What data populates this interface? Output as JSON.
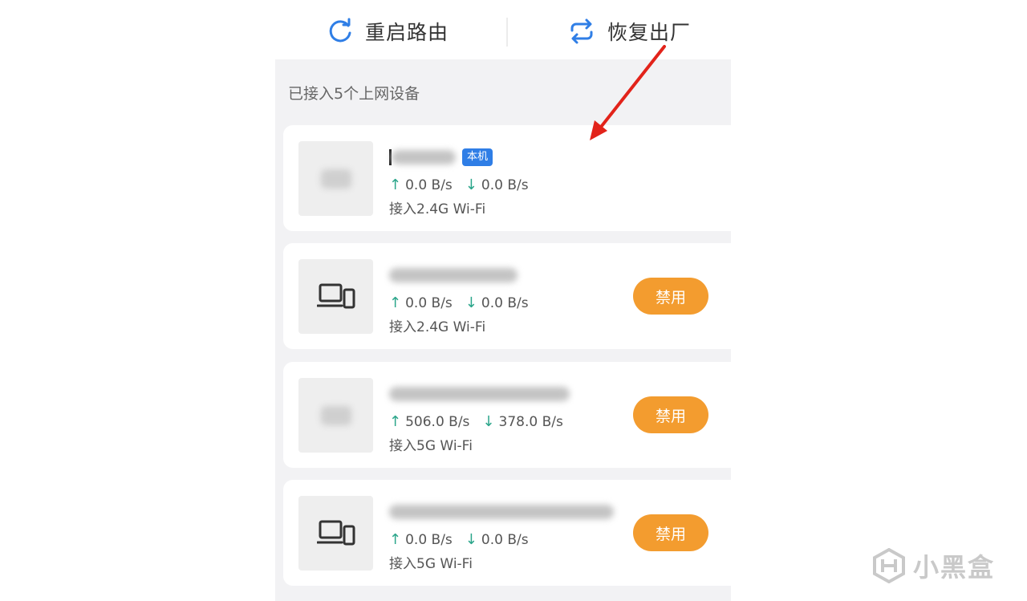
{
  "top_actions": {
    "restart_label": "重启路由",
    "factory_reset_label": "恢复出厂"
  },
  "section_title": "已接入5个上网设备",
  "devices": [
    {
      "badge": "本机",
      "up": "0.0 B/s",
      "down": "0.0 B/s",
      "connection": "接入2.4G Wi-Fi",
      "icon": "blurred-icon"
    },
    {
      "up": "0.0 B/s",
      "down": "0.0 B/s",
      "connection": "接入2.4G Wi-Fi",
      "action_label": "禁用",
      "icon": "laptop-phone-icon"
    },
    {
      "up": "506.0 B/s",
      "down": "378.0 B/s",
      "connection": "接入5G Wi-Fi",
      "action_label": "禁用",
      "icon": "blurred-icon"
    },
    {
      "up": "0.0 B/s",
      "down": "0.0 B/s",
      "connection": "接入5G Wi-Fi",
      "action_label": "禁用",
      "icon": "laptop-phone-icon"
    }
  ],
  "colors": {
    "accent_orange": "#f39c2f",
    "badge_blue": "#2f7ee6",
    "speed_arrow_green": "#2aa58a",
    "icon_blue": "#2f7ee6",
    "annotation_red": "#e2231a"
  },
  "watermark": "小黑盒"
}
